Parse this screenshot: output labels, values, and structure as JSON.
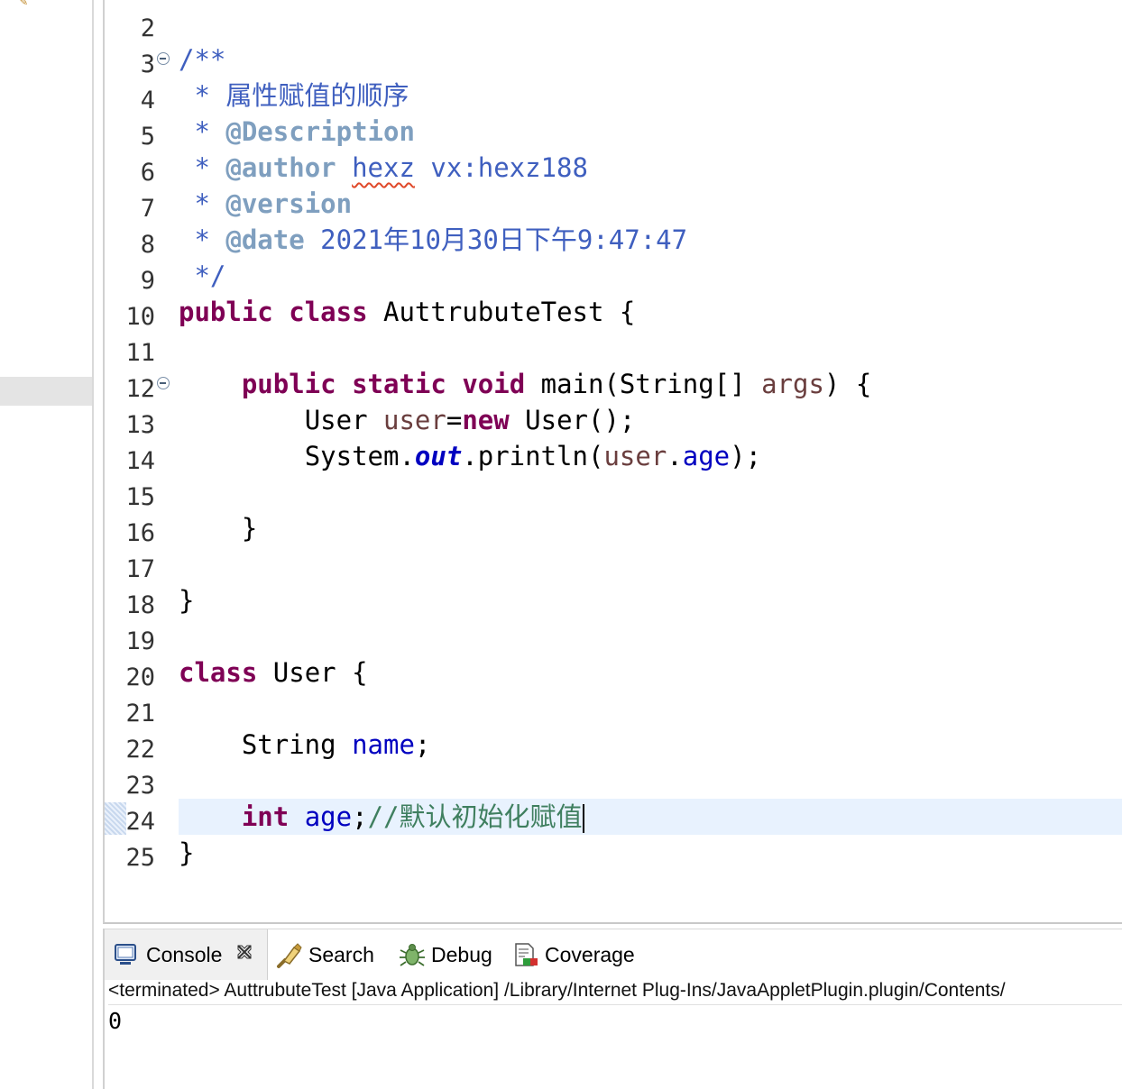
{
  "editor": {
    "lines": [
      {
        "num": "2"
      },
      {
        "num": "3",
        "fold": true,
        "text": "/**"
      },
      {
        "num": "4",
        "text": " * 属性赋值的顺序"
      },
      {
        "num": "5",
        "star": " * ",
        "tag": "@Description"
      },
      {
        "num": "6",
        "star": " * ",
        "tag": "@author",
        "rest_a": "hexz",
        "rest_b": " vx:hexz188"
      },
      {
        "num": "7",
        "star": " * ",
        "tag": "@version"
      },
      {
        "num": "8",
        "star": " * ",
        "tag": "@date",
        "rest_a": " 2021年10月30日下午9:47:47"
      },
      {
        "num": "9",
        "text": " */"
      },
      {
        "num": "10",
        "kw1": "public",
        "kw2": "class",
        "name": "AuttrubuteTest",
        "brace": "{"
      },
      {
        "num": "11"
      },
      {
        "num": "12",
        "fold": true,
        "kw1": "public",
        "kw2": "static",
        "kw3": "void",
        "method": "main(String[]",
        "param": "args",
        "end": ") {"
      },
      {
        "num": "13",
        "type": "User",
        "var": "user",
        "eq": "=",
        "kw": "new",
        "call": "User();"
      },
      {
        "num": "14",
        "sys": "System.",
        "out": "out",
        "println": ".println(",
        "var": "user",
        "dot": ".",
        "field": "age",
        "end": ");"
      },
      {
        "num": "15"
      },
      {
        "num": "16",
        "text": "}"
      },
      {
        "num": "17"
      },
      {
        "num": "18",
        "text": "}"
      },
      {
        "num": "19"
      },
      {
        "num": "20",
        "kw": "class",
        "name": "User",
        "brace": "{"
      },
      {
        "num": "21"
      },
      {
        "num": "22",
        "type": "String",
        "field": "name",
        "semi": ";"
      },
      {
        "num": "23"
      },
      {
        "num": "24",
        "kw": "int",
        "field": "age",
        "semi": ";",
        "comment": "//默认初始化赋值"
      },
      {
        "num": "25",
        "text": "}"
      }
    ]
  },
  "console": {
    "tabs": [
      {
        "label": "Console",
        "icon": "console-icon"
      },
      {
        "label": "Search",
        "icon": "search-icon"
      },
      {
        "label": "Debug",
        "icon": "debug-icon"
      },
      {
        "label": "Coverage",
        "icon": "coverage-icon"
      }
    ],
    "description": "<terminated> AuttrubuteTest [Java Application] /Library/Internet Plug-Ins/JavaAppletPlugin.plugin/Contents/",
    "output": "0"
  }
}
